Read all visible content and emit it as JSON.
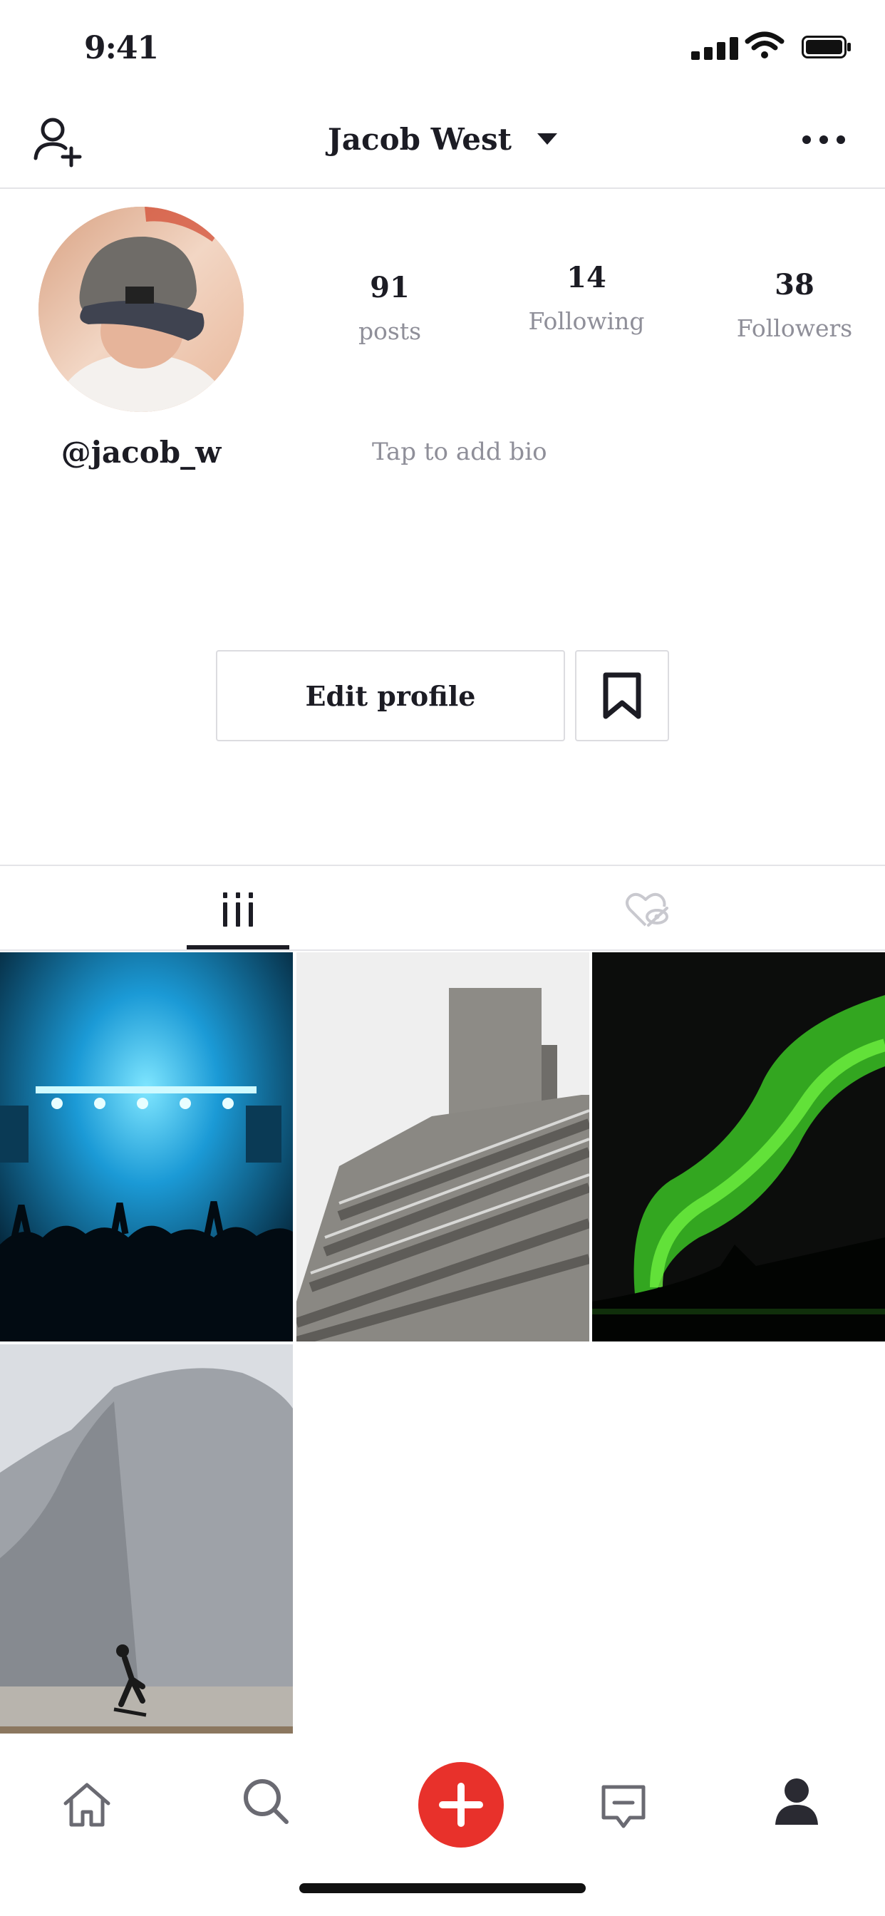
{
  "status_bar": {
    "time": "9:41"
  },
  "header": {
    "username": "Jacob West"
  },
  "profile": {
    "handle": "@jacob_w",
    "bio_placeholder": "Tap to add bio",
    "stats": [
      {
        "value": "91",
        "label": "posts"
      },
      {
        "value": "14",
        "label": "Following"
      },
      {
        "value": "38",
        "label": "Followers"
      }
    ]
  },
  "actions": {
    "edit_profile": "Edit profile"
  },
  "tabs": [
    {
      "icon": "grid-icon",
      "active": true
    },
    {
      "icon": "liked-hidden-icon",
      "active": false
    }
  ],
  "posts": [
    {
      "subject": "concert-stage"
    },
    {
      "subject": "brutalist-building"
    },
    {
      "subject": "aurora"
    },
    {
      "subject": "mountain-skater"
    }
  ],
  "bottom_nav": [
    {
      "icon": "home-icon"
    },
    {
      "icon": "search-icon"
    },
    {
      "icon": "create-icon"
    },
    {
      "icon": "messages-icon"
    },
    {
      "icon": "profile-icon",
      "active": true
    }
  ],
  "colors": {
    "accent": "#e8312b",
    "text": "#1c1c24",
    "muted": "#8f8f99",
    "divider": "#e4e4e8"
  }
}
